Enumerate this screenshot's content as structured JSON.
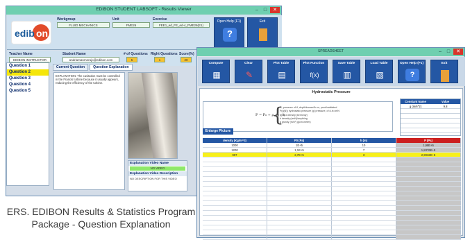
{
  "results_viewer": {
    "title": "EDIBON STUDENT LABSOFT - Results Viewer",
    "logo_text": "edibon",
    "fields": {
      "workgroup_label": "Workgroup",
      "workgroup_value": "FLUID MECHANICS",
      "unit_label": "Unit",
      "unit_value": "FME26",
      "exercise_label": "Exercise",
      "exercise_value": "FEE1_ed_FE_ed-4_FME26(E1)"
    },
    "buttons": {
      "open_help": "Open Help (F1)",
      "exit": "Exit"
    },
    "info": {
      "teacher_label": "Teacher Name",
      "teacher_value": "EDIBON INSTRUCTOR",
      "student_label": "Student Name",
      "student_value": "andriamanmerajo@edibon.com",
      "questions_label": "# of Questions",
      "questions_value": "5",
      "right_label": "Right Questions",
      "right_value": "1",
      "score_label": "Score(%)",
      "score_value": "20"
    },
    "questions": [
      "Question 1",
      "Question 2",
      "Question 3",
      "Question 4",
      "Question 5"
    ],
    "active_question": "Question 2",
    "tabs": [
      "Current Question",
      "Question Explanation"
    ],
    "explanation_text": "EXPLANATION: The cavitation must be controlled in the Francis turbine because it usually appears, reducing the efficiency of the turbine.",
    "video_name_label": "Explanation Video Name",
    "video_name_value": "NO VIDEO",
    "video_desc_label": "Explanation Video Description",
    "video_desc_value": "NO DESCRIPTION FOR THIS VIDEO"
  },
  "caption": "ERS. EDIBON Results & Statistics Program Package - Question Explanation",
  "spreadsheet": {
    "title": "SPREADSHEET",
    "toolbar": [
      {
        "label": "Compute",
        "icon": "calculator-icon"
      },
      {
        "label": "Clear",
        "icon": "eraser-icon"
      },
      {
        "label": "Plot Table",
        "icon": "chart-icon"
      },
      {
        "label": "Plot Function",
        "icon": "function-icon"
      },
      {
        "label": "Save Table",
        "icon": "save-table-icon"
      },
      {
        "label": "Load Table",
        "icon": "load-table-icon"
      },
      {
        "label": "Open Help (F1)",
        "icon": "help-icon"
      },
      {
        "label": "Exit",
        "icon": "exit-icon"
      }
    ],
    "sheet_title": "Hydrostatic Pressure",
    "formula": "P = P₀ + ρ · g · h",
    "formula_legend": [
      "P₀ pressure of tf, depth/known/fix m, proof/validated",
      "P(g(N)) hydrostatic pressure (g) pressure, of d-in cmN",
      "ρ(m) d density (kennedy)",
      "h density (cmN)/anything",
      "g gravity (m/s²) g(cm-meter)"
    ],
    "enlarge_label": "Enlarge Picture",
    "constants": {
      "headers": [
        "Constant Name",
        "Value"
      ],
      "rows": [
        [
          "g (m/s^2)",
          "9.8"
        ],
        [
          "",
          ""
        ],
        [
          "",
          ""
        ],
        [
          "",
          ""
        ],
        [
          "",
          ""
        ],
        [
          "",
          ""
        ]
      ]
    },
    "table": {
      "headers": [
        "density (Kg/m^3)",
        "P0 (Pa)",
        "h (m)",
        "P (Pa)"
      ],
      "rows": [
        [
          "1000",
          "1E+5",
          "10",
          "1,98E+5"
        ],
        [
          "1200",
          "1,1E+5",
          "7",
          "1,8376E+5"
        ],
        [
          "997",
          "2,7E+5",
          "3",
          "2,9932E+5"
        ]
      ],
      "highlighted_row": 2,
      "empty_rows": 17
    },
    "accent_color": "#2457a4",
    "highlight_color": "#f7f01a",
    "result_header_color": "#cc1f1f"
  }
}
